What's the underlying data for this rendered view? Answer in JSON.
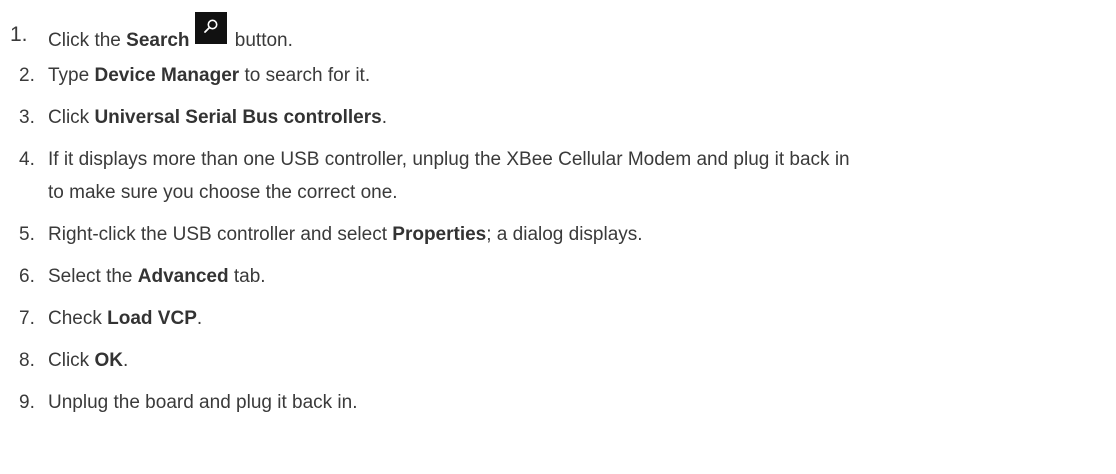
{
  "steps": [
    {
      "number": "1.",
      "text_before": "Click the ",
      "bold": "Search",
      "text_after": " button.",
      "icon": "search-icon"
    },
    {
      "number": "2.",
      "text_before": "Type ",
      "bold": "Device Manager",
      "text_after": " to search for it."
    },
    {
      "number": "3.",
      "text_before": "Click ",
      "bold": "Universal Serial Bus controllers",
      "text_after": "."
    },
    {
      "number": "4.",
      "line1": "If it displays more than one USB controller, unplug the XBee Cellular Modem and plug it back in",
      "line2": "to make sure you choose the correct one."
    },
    {
      "number": "5.",
      "text_before": "Right-click the USB controller and select ",
      "bold": "Properties",
      "text_after": "; a dialog displays."
    },
    {
      "number": "6.",
      "text_before": "Select the ",
      "bold": "Advanced",
      "text_after": " tab."
    },
    {
      "number": "7.",
      "text_before": "Check ",
      "bold": "Load VCP",
      "text_after": "."
    },
    {
      "number": "8.",
      "text_before": "Click ",
      "bold": "OK",
      "text_after": "."
    },
    {
      "number": "9.",
      "text": "Unplug the board and plug it back in."
    }
  ]
}
